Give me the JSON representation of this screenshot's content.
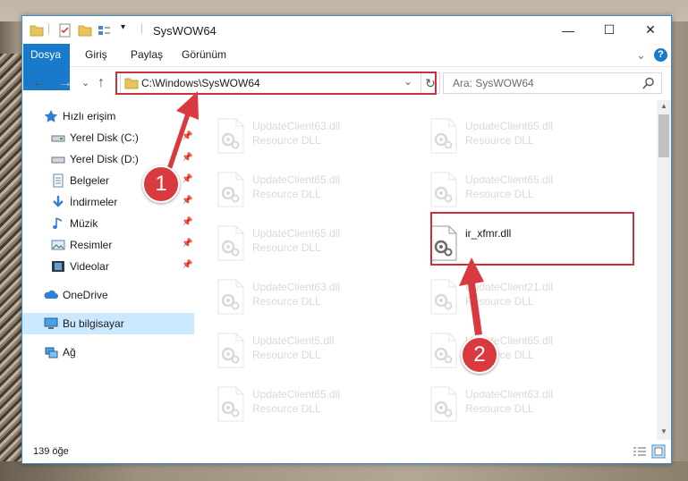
{
  "window": {
    "title": "SysWOW64",
    "controls": {
      "minimize": "—",
      "maximize": "☐",
      "close": "✕"
    }
  },
  "ribbon": {
    "tabs": [
      "Dosya",
      "Giriş",
      "Paylaş",
      "Görünüm"
    ],
    "expand": "⌄",
    "help": "?"
  },
  "nav": {
    "back": "←",
    "forward": "→",
    "recent": "⌄",
    "up": "↑",
    "address": "C:\\Windows\\SysWOW64",
    "address_dropdown": "⌄",
    "refresh": "↻",
    "search_placeholder": "Ara: SysWOW64"
  },
  "sidebar": {
    "items": [
      {
        "label": "Hızlı erişim",
        "icon": "star-icon",
        "pinned": false
      },
      {
        "label": "Yerel Disk (C:)",
        "icon": "drive-icon",
        "pinned": true
      },
      {
        "label": "Yerel Disk (D:)",
        "icon": "drive-icon",
        "pinned": true
      },
      {
        "label": "Belgeler",
        "icon": "documents-icon",
        "pinned": true
      },
      {
        "label": "İndirmeler",
        "icon": "download-icon",
        "pinned": true
      },
      {
        "label": "Müzik",
        "icon": "music-icon",
        "pinned": true
      },
      {
        "label": "Resimler",
        "icon": "pictures-icon",
        "pinned": true
      },
      {
        "label": "Videolar",
        "icon": "videos-icon",
        "pinned": true
      },
      {
        "label": "OneDrive",
        "icon": "cloud-icon",
        "pinned": false
      },
      {
        "label": "Bu bilgisayar",
        "icon": "computer-icon",
        "pinned": false,
        "selected": true
      },
      {
        "label": "Ağ",
        "icon": "network-icon",
        "pinned": false
      }
    ]
  },
  "files": [
    {
      "name": "UpdateClient63.dll",
      "desc": "Resource DLL"
    },
    {
      "name": "UpdateClient65.dll",
      "desc": "Resource DLL"
    },
    {
      "name": "UpdateClient65.dll",
      "desc": "Resource DLL"
    },
    {
      "name": "UpdateClient65.dll",
      "desc": "Resource DLL"
    },
    {
      "name": "UpdateClient65.dll",
      "desc": "Resource DLL"
    },
    {
      "name": "ir_xfmr.dll",
      "desc": ""
    },
    {
      "name": "UpdateClient63.dll",
      "desc": "Resource DLL"
    },
    {
      "name": "UpdateClient21.dll",
      "desc": "Resource DLL"
    },
    {
      "name": "UpdateClient5.dll",
      "desc": "Resource DLL"
    },
    {
      "name": "UpdateClient65.dll",
      "desc": "Resource DLL"
    },
    {
      "name": "UpdateClient65.dll",
      "desc": "Resource DLL"
    },
    {
      "name": "UpdateClient63.dll",
      "desc": "Resource DLL"
    }
  ],
  "status": {
    "count": "139 öğe"
  },
  "annotations": {
    "step1": "1",
    "step2": "2"
  },
  "colors": {
    "accent": "#1979ca",
    "highlight_red": "#c7323d",
    "selected_bg": "#cce8ff"
  }
}
